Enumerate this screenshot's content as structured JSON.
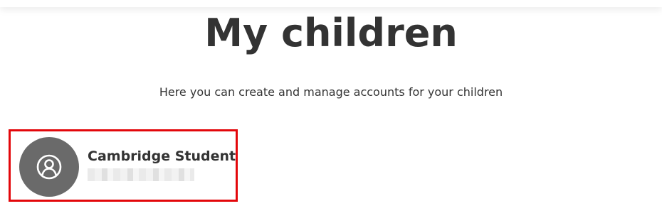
{
  "header": {
    "title": "My children",
    "subtitle": "Here you can create and manage accounts for your children"
  },
  "children": [
    {
      "name": "Cambridge Student",
      "email": "",
      "avatar_icon": "user-circle-icon"
    }
  ],
  "colors": {
    "highlight_border": "#e3070b",
    "avatar_bg": "#6a6a6a",
    "text": "#333333"
  }
}
